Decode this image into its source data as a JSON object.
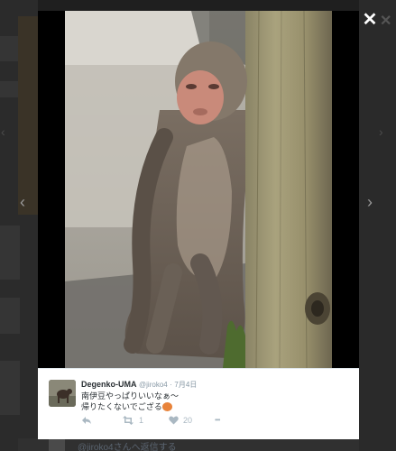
{
  "tweet": {
    "name": "Degenko-UMA",
    "handle": "@jiroko4",
    "separator": "·",
    "date": "7月4日",
    "line1": "南伊豆やっぱりいいなぁ～",
    "line2": "帰りたくないでござる",
    "retweet_count": "1",
    "like_count": "20",
    "more_label": "•••"
  },
  "viewer": {
    "close_label": "✕",
    "prev_label": "‹",
    "next_label": "›"
  },
  "background": {
    "bottom_text": "@jiroko4さんへ返信する",
    "close_label": "✕",
    "prev_label": "‹",
    "next_label": "›"
  },
  "icons": {
    "reply": "reply-icon",
    "retweet": "retweet-icon",
    "like": "heart-icon",
    "more": "more-icon",
    "close": "close-icon"
  },
  "colors": {
    "card_bg": "#ffffff",
    "name_text": "#292f33",
    "meta_text": "#8899a6",
    "action_icons": "#aab8c2",
    "overlay": "#1f1f1f"
  }
}
